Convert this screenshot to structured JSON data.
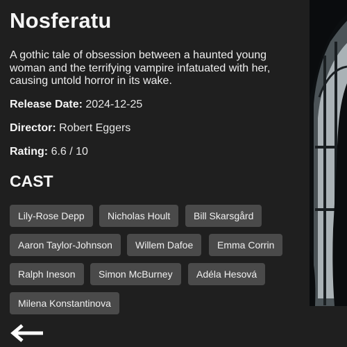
{
  "movie": {
    "title": "Nosferatu",
    "overview": "A gothic tale of obsession between a haunted young woman and the terrifying vampire infatuated with her, causing untold horror in its wake.",
    "release": {
      "label": "Release Date:",
      "value": "2024-12-25"
    },
    "director": {
      "label": "Director:",
      "value": "Robert Eggers"
    },
    "rating": {
      "label": "Rating:",
      "value": "6.6 / 10"
    }
  },
  "cast": {
    "heading": "CAST",
    "members": [
      "Lily-Rose Depp",
      "Nicholas Hoult",
      "Bill Skarsgård",
      "Aaron Taylor-Johnson",
      "Willem Dafoe",
      "Emma Corrin",
      "Ralph Ineson",
      "Simon McBurney",
      "Adéla Hesová",
      "Milena Konstantinova"
    ]
  },
  "icons": {
    "back": "arrow-left-icon"
  },
  "colors": {
    "background": "#1f1f1f",
    "chip": "#4a4a4a",
    "text": "#f2f2f2"
  }
}
